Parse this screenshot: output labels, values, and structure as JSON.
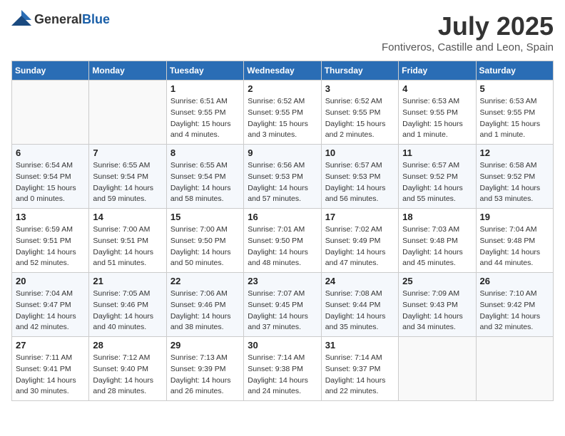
{
  "header": {
    "logo_general": "General",
    "logo_blue": "Blue",
    "title": "July 2025",
    "subtitle": "Fontiveros, Castille and Leon, Spain"
  },
  "days_of_week": [
    "Sunday",
    "Monday",
    "Tuesday",
    "Wednesday",
    "Thursday",
    "Friday",
    "Saturday"
  ],
  "weeks": [
    [
      {
        "day": "",
        "detail": ""
      },
      {
        "day": "",
        "detail": ""
      },
      {
        "day": "1",
        "detail": "Sunrise: 6:51 AM\nSunset: 9:55 PM\nDaylight: 15 hours and 4 minutes."
      },
      {
        "day": "2",
        "detail": "Sunrise: 6:52 AM\nSunset: 9:55 PM\nDaylight: 15 hours and 3 minutes."
      },
      {
        "day": "3",
        "detail": "Sunrise: 6:52 AM\nSunset: 9:55 PM\nDaylight: 15 hours and 2 minutes."
      },
      {
        "day": "4",
        "detail": "Sunrise: 6:53 AM\nSunset: 9:55 PM\nDaylight: 15 hours and 1 minute."
      },
      {
        "day": "5",
        "detail": "Sunrise: 6:53 AM\nSunset: 9:55 PM\nDaylight: 15 hours and 1 minute."
      }
    ],
    [
      {
        "day": "6",
        "detail": "Sunrise: 6:54 AM\nSunset: 9:54 PM\nDaylight: 15 hours and 0 minutes."
      },
      {
        "day": "7",
        "detail": "Sunrise: 6:55 AM\nSunset: 9:54 PM\nDaylight: 14 hours and 59 minutes."
      },
      {
        "day": "8",
        "detail": "Sunrise: 6:55 AM\nSunset: 9:54 PM\nDaylight: 14 hours and 58 minutes."
      },
      {
        "day": "9",
        "detail": "Sunrise: 6:56 AM\nSunset: 9:53 PM\nDaylight: 14 hours and 57 minutes."
      },
      {
        "day": "10",
        "detail": "Sunrise: 6:57 AM\nSunset: 9:53 PM\nDaylight: 14 hours and 56 minutes."
      },
      {
        "day": "11",
        "detail": "Sunrise: 6:57 AM\nSunset: 9:52 PM\nDaylight: 14 hours and 55 minutes."
      },
      {
        "day": "12",
        "detail": "Sunrise: 6:58 AM\nSunset: 9:52 PM\nDaylight: 14 hours and 53 minutes."
      }
    ],
    [
      {
        "day": "13",
        "detail": "Sunrise: 6:59 AM\nSunset: 9:51 PM\nDaylight: 14 hours and 52 minutes."
      },
      {
        "day": "14",
        "detail": "Sunrise: 7:00 AM\nSunset: 9:51 PM\nDaylight: 14 hours and 51 minutes."
      },
      {
        "day": "15",
        "detail": "Sunrise: 7:00 AM\nSunset: 9:50 PM\nDaylight: 14 hours and 50 minutes."
      },
      {
        "day": "16",
        "detail": "Sunrise: 7:01 AM\nSunset: 9:50 PM\nDaylight: 14 hours and 48 minutes."
      },
      {
        "day": "17",
        "detail": "Sunrise: 7:02 AM\nSunset: 9:49 PM\nDaylight: 14 hours and 47 minutes."
      },
      {
        "day": "18",
        "detail": "Sunrise: 7:03 AM\nSunset: 9:48 PM\nDaylight: 14 hours and 45 minutes."
      },
      {
        "day": "19",
        "detail": "Sunrise: 7:04 AM\nSunset: 9:48 PM\nDaylight: 14 hours and 44 minutes."
      }
    ],
    [
      {
        "day": "20",
        "detail": "Sunrise: 7:04 AM\nSunset: 9:47 PM\nDaylight: 14 hours and 42 minutes."
      },
      {
        "day": "21",
        "detail": "Sunrise: 7:05 AM\nSunset: 9:46 PM\nDaylight: 14 hours and 40 minutes."
      },
      {
        "day": "22",
        "detail": "Sunrise: 7:06 AM\nSunset: 9:46 PM\nDaylight: 14 hours and 38 minutes."
      },
      {
        "day": "23",
        "detail": "Sunrise: 7:07 AM\nSunset: 9:45 PM\nDaylight: 14 hours and 37 minutes."
      },
      {
        "day": "24",
        "detail": "Sunrise: 7:08 AM\nSunset: 9:44 PM\nDaylight: 14 hours and 35 minutes."
      },
      {
        "day": "25",
        "detail": "Sunrise: 7:09 AM\nSunset: 9:43 PM\nDaylight: 14 hours and 34 minutes."
      },
      {
        "day": "26",
        "detail": "Sunrise: 7:10 AM\nSunset: 9:42 PM\nDaylight: 14 hours and 32 minutes."
      }
    ],
    [
      {
        "day": "27",
        "detail": "Sunrise: 7:11 AM\nSunset: 9:41 PM\nDaylight: 14 hours and 30 minutes."
      },
      {
        "day": "28",
        "detail": "Sunrise: 7:12 AM\nSunset: 9:40 PM\nDaylight: 14 hours and 28 minutes."
      },
      {
        "day": "29",
        "detail": "Sunrise: 7:13 AM\nSunset: 9:39 PM\nDaylight: 14 hours and 26 minutes."
      },
      {
        "day": "30",
        "detail": "Sunrise: 7:14 AM\nSunset: 9:38 PM\nDaylight: 14 hours and 24 minutes."
      },
      {
        "day": "31",
        "detail": "Sunrise: 7:14 AM\nSunset: 9:37 PM\nDaylight: 14 hours and 22 minutes."
      },
      {
        "day": "",
        "detail": ""
      },
      {
        "day": "",
        "detail": ""
      }
    ]
  ]
}
